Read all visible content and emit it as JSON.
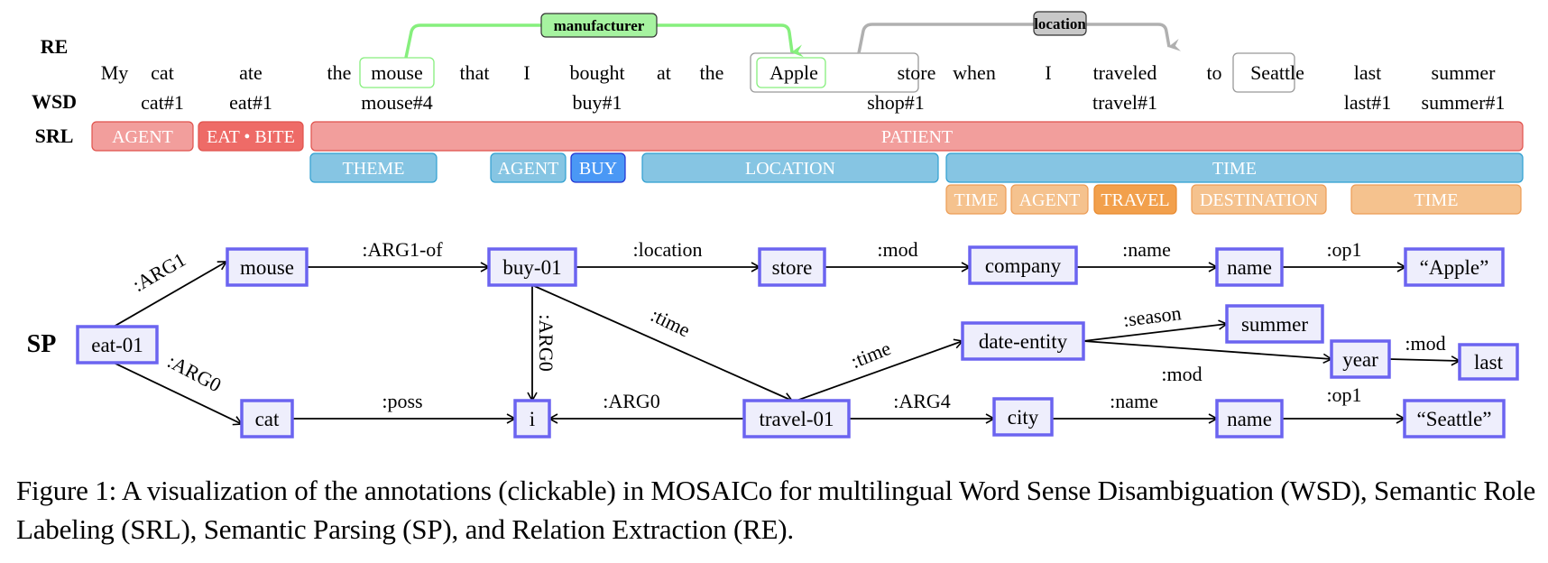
{
  "row_labels": {
    "re": "RE",
    "wsd": "WSD",
    "srl": "SRL",
    "sp": "SP"
  },
  "tokens": [
    "My",
    "cat",
    "ate",
    "the",
    "mouse",
    "that",
    "I",
    "bought",
    "at",
    "the",
    "Apple",
    "store",
    "when",
    "I",
    "traveled",
    "to",
    "Seattle",
    "last",
    "summer"
  ],
  "wsd": [
    {
      "token": 1,
      "label": "cat#1"
    },
    {
      "token": 2,
      "label": "eat#1"
    },
    {
      "token": 4,
      "label": "mouse#4"
    },
    {
      "token": 7,
      "label": "buy#1"
    },
    {
      "token": 11,
      "label": "shop#1"
    },
    {
      "token": 14,
      "label": "travel#1"
    },
    {
      "token": 17,
      "label": "last#1"
    },
    {
      "token": 18,
      "label": "summer#1"
    }
  ],
  "re": {
    "relations": [
      {
        "label": "manufacturer",
        "head": "mouse",
        "tail": "Apple",
        "color": "#86ef7d",
        "label_bg": "#a6f3a0"
      },
      {
        "label": "location",
        "head": "Apple store",
        "tail": "Seattle",
        "color": "#b0b0b0",
        "label_bg": "#c8c8c8"
      }
    ]
  },
  "srl": {
    "rows": [
      [
        {
          "label": "AGENT",
          "kind": "red-light"
        },
        {
          "label": "EAT • BITE",
          "kind": "red-dark"
        },
        {
          "label": "PATIENT",
          "kind": "red-light"
        }
      ],
      [
        {
          "label": "THEME",
          "kind": "blue-light"
        },
        {
          "label": "AGENT",
          "kind": "blue-light"
        },
        {
          "label": "BUY",
          "kind": "blue-dark"
        },
        {
          "label": "LOCATION",
          "kind": "blue-light"
        },
        {
          "label": "TIME",
          "kind": "blue-light"
        }
      ],
      [
        {
          "label": "TIME",
          "kind": "orange-light"
        },
        {
          "label": "AGENT",
          "kind": "orange-light"
        },
        {
          "label": "TRAVEL",
          "kind": "orange-dark"
        },
        {
          "label": "DESTINATION",
          "kind": "orange-light"
        },
        {
          "label": "TIME",
          "kind": "orange-light"
        }
      ]
    ],
    "colors": {
      "red-light": "#f29e9c",
      "red-dark": "#ee6b67",
      "blue-light": "#86c5e3",
      "blue-dark": "#4a98f5",
      "orange-light": "#f5c28e",
      "orange-dark": "#f2a04c"
    }
  },
  "sp": {
    "nodes": [
      {
        "id": "eat",
        "label": "eat-01"
      },
      {
        "id": "mouse",
        "label": "mouse"
      },
      {
        "id": "cat",
        "label": "cat"
      },
      {
        "id": "buy",
        "label": "buy-01"
      },
      {
        "id": "i",
        "label": "i"
      },
      {
        "id": "store",
        "label": "store"
      },
      {
        "id": "company",
        "label": "company"
      },
      {
        "id": "name1",
        "label": "name"
      },
      {
        "id": "apple",
        "label": "“Apple”"
      },
      {
        "id": "travel",
        "label": "travel-01"
      },
      {
        "id": "date",
        "label": "date-entity"
      },
      {
        "id": "summer",
        "label": "summer"
      },
      {
        "id": "year",
        "label": "year"
      },
      {
        "id": "last",
        "label": "last"
      },
      {
        "id": "city",
        "label": "city"
      },
      {
        "id": "name2",
        "label": "name"
      },
      {
        "id": "seattle",
        "label": "“Seattle”"
      }
    ],
    "edges": [
      {
        "from": "eat",
        "to": "mouse",
        "label": ":ARG1"
      },
      {
        "from": "eat",
        "to": "cat",
        "label": ":ARG0"
      },
      {
        "from": "mouse",
        "to": "buy",
        "label": ":ARG1-of"
      },
      {
        "from": "cat",
        "to": "i",
        "label": ":poss"
      },
      {
        "from": "buy",
        "to": "i",
        "label": ":ARG0"
      },
      {
        "from": "buy",
        "to": "store",
        "label": ":location"
      },
      {
        "from": "buy",
        "to": "travel",
        "label": ":time"
      },
      {
        "from": "store",
        "to": "company",
        "label": ":mod"
      },
      {
        "from": "company",
        "to": "name1",
        "label": ":name"
      },
      {
        "from": "name1",
        "to": "apple",
        "label": ":op1"
      },
      {
        "from": "travel",
        "to": "i",
        "label": ":ARG0"
      },
      {
        "from": "travel",
        "to": "date",
        "label": ":time"
      },
      {
        "from": "travel",
        "to": "city",
        "label": ":ARG4"
      },
      {
        "from": "date",
        "to": "summer",
        "label": ":season"
      },
      {
        "from": "date",
        "to": "year",
        "label": ":mod"
      },
      {
        "from": "year",
        "to": "last",
        "label": ":mod"
      },
      {
        "from": "city",
        "to": "name2",
        "label": ":name"
      },
      {
        "from": "name2",
        "to": "seattle",
        "label": ":op1"
      }
    ],
    "node_fill": "#eeeefc",
    "node_stroke": "#6b64f0"
  },
  "caption": "Figure 1: A visualization of the annotations (clickable) in MOSAICo for multilingual Word Sense Disambiguation (WSD), Semantic Role Labeling (SRL), Semantic Parsing (SP), and Relation Extraction (RE)."
}
